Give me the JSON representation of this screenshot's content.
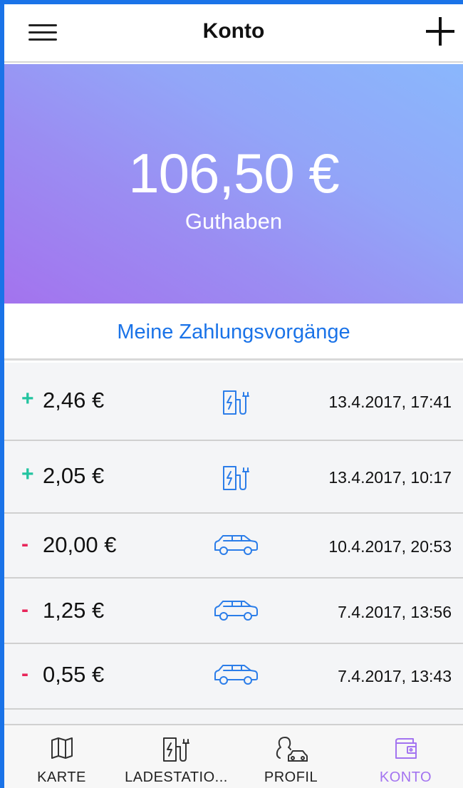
{
  "header": {
    "title": "Konto",
    "menu_icon": "hamburger-menu-icon",
    "add_icon": "plus-icon"
  },
  "balance": {
    "amount": "106,50 €",
    "label": "Guthaben"
  },
  "section": {
    "title": "Meine Zahlungsvorgänge"
  },
  "transactions": [
    {
      "sign": "+",
      "amount": "2,46 €",
      "icon": "charging-station-icon",
      "date": "13.4.2017, 17:41"
    },
    {
      "sign": "+",
      "amount": "2,05 €",
      "icon": "charging-station-icon",
      "date": "13.4.2017, 10:17"
    },
    {
      "sign": "-",
      "amount": "20,00 €",
      "icon": "car-icon",
      "date": "10.4.2017, 20:53"
    },
    {
      "sign": "-",
      "amount": "1,25 €",
      "icon": "car-icon",
      "date": "7.4.2017, 13:56"
    },
    {
      "sign": "-",
      "amount": "0,55 €",
      "icon": "car-icon",
      "date": "7.4.2017, 13:43"
    }
  ],
  "tabs": [
    {
      "label": "KARTE",
      "icon": "map-icon",
      "active": false
    },
    {
      "label": "LADESTATIO...",
      "icon": "charging-station-icon",
      "active": false
    },
    {
      "label": "PROFIL",
      "icon": "profile-car-icon",
      "active": false
    },
    {
      "label": "KONTO",
      "icon": "wallet-icon",
      "active": true
    }
  ],
  "colors": {
    "accent": "#1a73e8",
    "active_tab": "#a374f0",
    "plus": "#23c4a0",
    "minus": "#e8255a",
    "icon_blue": "#2b7de9",
    "gradient_start": "#a373ee",
    "gradient_end": "#8ab7fc"
  }
}
